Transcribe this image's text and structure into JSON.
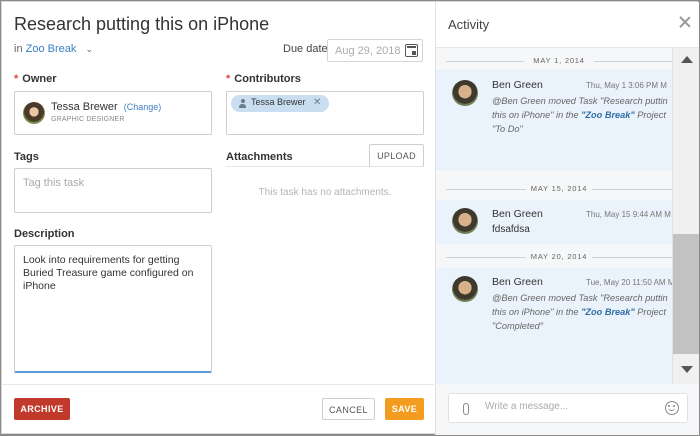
{
  "task": {
    "title": "Research putting this on iPhone",
    "in_prefix": "in",
    "project": "Zoo Break",
    "due_label": "Due date",
    "due_value": "Aug 29, 2018"
  },
  "owner": {
    "label": "Owner",
    "name": "Tessa Brewer",
    "change_label": "(Change)",
    "role": "GRAPHIC DESIGNER"
  },
  "contributors": {
    "label": "Contributors",
    "items": [
      {
        "name": "Tessa Brewer"
      }
    ]
  },
  "tags": {
    "label": "Tags",
    "placeholder": "Tag this task"
  },
  "attachments": {
    "label": "Attachments",
    "upload_label": "UPLOAD",
    "empty_text": "This task has no attachments."
  },
  "description": {
    "label": "Description",
    "value": "Look into requirements for getting Buried Treasure game configured on iPhone"
  },
  "footer": {
    "archive_label": "ARCHIVE",
    "cancel_label": "CANCEL",
    "save_label": "SAVE"
  },
  "activity": {
    "title": "Activity",
    "groups": [
      {
        "date": "MAY 1, 2014",
        "author": "Ben Green",
        "time": "Thu, May 1 3:06 PM M",
        "text_pre": "@Ben Green moved Task \"Research puttin",
        "text_line2_pre": "this on iPhone\" in the ",
        "text_link": "\"Zoo Break\"",
        "text_line2_post": " Project",
        "text_line3": "\"To Do\""
      },
      {
        "date": "MAY 15, 2014",
        "author": "Ben Green",
        "time": "Thu, May 15 9:44 AM M",
        "comment": "fdsafdsa"
      },
      {
        "date": "MAY 20, 2014",
        "author": "Ben Green",
        "time": "Tue, May 20 11:50 AM M",
        "text_pre": "@Ben Green moved Task \"Research puttin",
        "text_line2_pre": "this on iPhone\" in the ",
        "text_link": "\"Zoo Break\"",
        "text_line2_post": " Project",
        "text_line3": "\"Completed\""
      }
    ],
    "composer_placeholder": "Write a message..."
  },
  "colors": {
    "accent": "#3a7fc1",
    "archive": "#c0392b",
    "save": "#f39c1f",
    "required": "#e0433a"
  }
}
